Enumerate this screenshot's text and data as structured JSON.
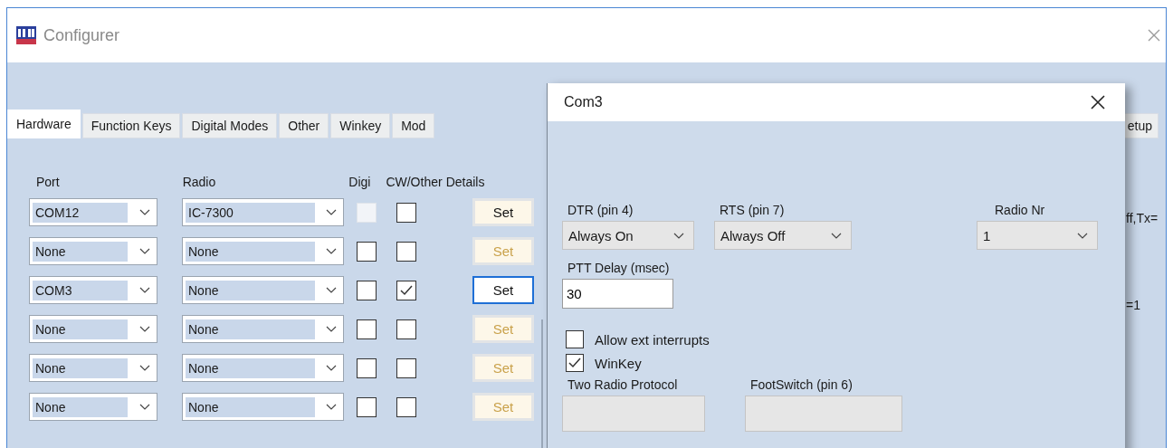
{
  "window": {
    "title": "Configurer"
  },
  "tabs": [
    {
      "label": "Hardware",
      "selected": true
    },
    {
      "label": "Function Keys",
      "selected": false
    },
    {
      "label": "Digital Modes",
      "selected": false
    },
    {
      "label": "Other",
      "selected": false
    },
    {
      "label": "Winkey",
      "selected": false
    },
    {
      "label": "Mod",
      "selected": false
    }
  ],
  "right_tab": {
    "label": "etup",
    "selected": false
  },
  "columns": [
    "Port",
    "Radio",
    "Digi",
    "CW/Other",
    "Details"
  ],
  "rows": [
    {
      "port": "COM12",
      "radio": "IC-7300",
      "digi": {
        "checked": false,
        "disabled": true
      },
      "cw": {
        "checked": false
      },
      "details": {
        "label": "Set",
        "enabled": true,
        "focused": false
      }
    },
    {
      "port": "None",
      "radio": "None",
      "digi": {
        "checked": false,
        "disabled": false
      },
      "cw": {
        "checked": false
      },
      "details": {
        "label": "Set",
        "enabled": false,
        "focused": false
      }
    },
    {
      "port": "COM3",
      "radio": "None",
      "digi": {
        "checked": false,
        "disabled": false
      },
      "cw": {
        "checked": true
      },
      "details": {
        "label": "Set",
        "enabled": true,
        "focused": true
      }
    },
    {
      "port": "None",
      "radio": "None",
      "digi": {
        "checked": false,
        "disabled": false
      },
      "cw": {
        "checked": false
      },
      "details": {
        "label": "Set",
        "enabled": false,
        "focused": false
      }
    },
    {
      "port": "None",
      "radio": "None",
      "digi": {
        "checked": false,
        "disabled": false
      },
      "cw": {
        "checked": false
      },
      "details": {
        "label": "Set",
        "enabled": false,
        "focused": false
      }
    },
    {
      "port": "None",
      "radio": "None",
      "digi": {
        "checked": false,
        "disabled": false
      },
      "cw": {
        "checked": false
      },
      "details": {
        "label": "Set",
        "enabled": false,
        "focused": false
      }
    }
  ],
  "right_texts": [
    "ff,Tx=",
    "=1"
  ],
  "dialog": {
    "title": "Com3",
    "dtr": {
      "label": "DTR (pin 4)",
      "value": "Always On"
    },
    "rts": {
      "label": "RTS (pin 7)",
      "value": "Always Off"
    },
    "radio_nr": {
      "label": "Radio Nr",
      "value": "1"
    },
    "ptt_delay": {
      "label": "PTT Delay  (msec)",
      "value": "30"
    },
    "options": [
      {
        "label": "Allow ext interrupts",
        "checked": false
      },
      {
        "label": "WinKey",
        "checked": true
      }
    ],
    "two_radio_protocol": {
      "label": "Two Radio Protocol"
    },
    "footswitch": {
      "label": "FootSwitch (pin 6)"
    }
  }
}
